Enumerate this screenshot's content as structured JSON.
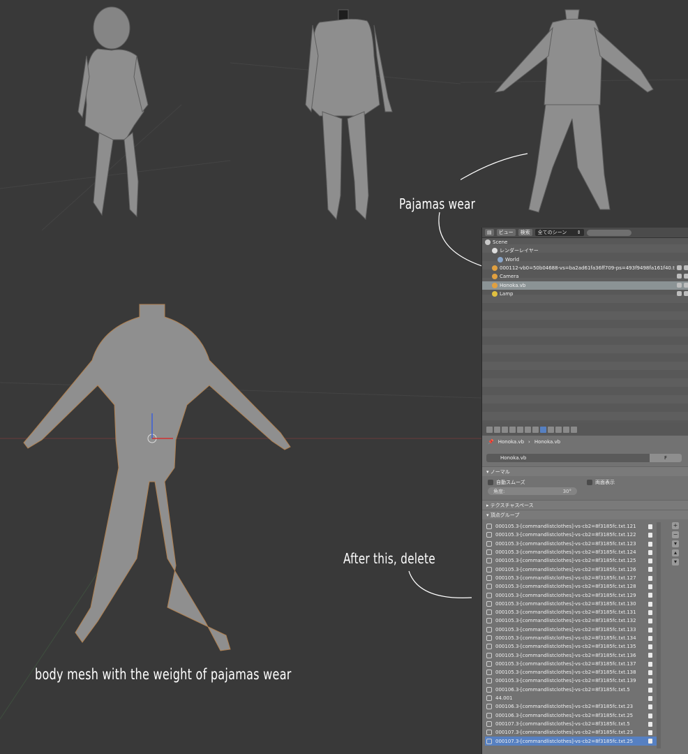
{
  "annotations": {
    "pajamas": "Pajamas wear",
    "delete": "After this, delete",
    "body": "body mesh with the weight of pajamas wear"
  },
  "outliner": {
    "header": {
      "view": "ビュー",
      "search": "検索",
      "scope": "全てのシーン",
      "scope_arrow": "⇕"
    },
    "rows": [
      {
        "label": "Scene",
        "icon": "scene-icon",
        "selected": false
      },
      {
        "label": "レンダーレイヤー",
        "icon": "render-layer-icon",
        "selected": false
      },
      {
        "label": "World",
        "icon": "world-icon",
        "selected": false
      },
      {
        "label": "000112-vb0=50b04688-vs=ba2ad61fa36ff709-ps=493f9498fa161f40.t",
        "icon": "mesh-icon",
        "selected": false
      },
      {
        "label": "Camera",
        "icon": "camera-icon",
        "selected": false
      },
      {
        "label": "Honoka.vb",
        "icon": "mesh-icon",
        "selected": true
      },
      {
        "label": "Lamp",
        "icon": "lamp-icon",
        "selected": false
      }
    ]
  },
  "properties": {
    "breadcrumb": {
      "object": "Honoka.vb",
      "mesh": "Honoka.vb"
    },
    "mesh_name": "Honoka.vb",
    "fake_user": "F",
    "normals_panel": "ノーマル",
    "auto_smooth": "自動スムーズ",
    "double_sided": "両面表示",
    "angle_label": "角度:",
    "angle_value": "30°",
    "texture_space_panel": "テクスチャスペース",
    "vertex_groups_panel": "頂点グループ",
    "vertex_groups": [
      "000105.3-[commandlistclothes]-vs-cb2=8f3185fc.txt.121",
      "000105.3-[commandlistclothes]-vs-cb2=8f3185fc.txt.122",
      "000105.3-[commandlistclothes]-vs-cb2=8f3185fc.txt.123",
      "000105.3-[commandlistclothes]-vs-cb2=8f3185fc.txt.124",
      "000105.3-[commandlistclothes]-vs-cb2=8f3185fc.txt.125",
      "000105.3-[commandlistclothes]-vs-cb2=8f3185fc.txt.126",
      "000105.3-[commandlistclothes]-vs-cb2=8f3185fc.txt.127",
      "000105.3-[commandlistclothes]-vs-cb2=8f3185fc.txt.128",
      "000105.3-[commandlistclothes]-vs-cb2=8f3185fc.txt.129",
      "000105.3-[commandlistclothes]-vs-cb2=8f3185fc.txt.130",
      "000105.3-[commandlistclothes]-vs-cb2=8f3185fc.txt.131",
      "000105.3-[commandlistclothes]-vs-cb2=8f3185fc.txt.132",
      "000105.3-[commandlistclothes]-vs-cb2=8f3185fc.txt.133",
      "000105.3-[commandlistclothes]-vs-cb2=8f3185fc.txt.134",
      "000105.3-[commandlistclothes]-vs-cb2=8f3185fc.txt.135",
      "000105.3-[commandlistclothes]-vs-cb2=8f3185fc.txt.136",
      "000105.3-[commandlistclothes]-vs-cb2=8f3185fc.txt.137",
      "000105.3-[commandlistclothes]-vs-cb2=8f3185fc.txt.138",
      "000105.3-[commandlistclothes]-vs-cb2=8f3185fc.txt.139",
      "000106.3-[commandlistclothes]-vs-cb2=8f3185fc.txt.5",
      "44.001",
      "000106.3-[commandlistclothes]-vs-cb2=8f3185fc.txt.23",
      "000106.3-[commandlistclothes]-vs-cb2=8f3185fc.txt.25",
      "000107.3-[commandlistclothes]-vs-cb2=8f3185fc.txt.5",
      "000107.3-[commandlistclothes]-vs-cb2=8f3185fc.txt.23",
      "000107.3-[commandlistclothes]-vs-cb2=8f3185fc.txt.25"
    ],
    "selected_group_index": 25,
    "side_buttons": [
      "+",
      "−",
      "▾",
      "▴",
      "▾"
    ]
  },
  "colors": {
    "viewport_bg": "#393939",
    "selection_blue": "#5680c2",
    "mesh_grey": "#8f8f8f"
  }
}
